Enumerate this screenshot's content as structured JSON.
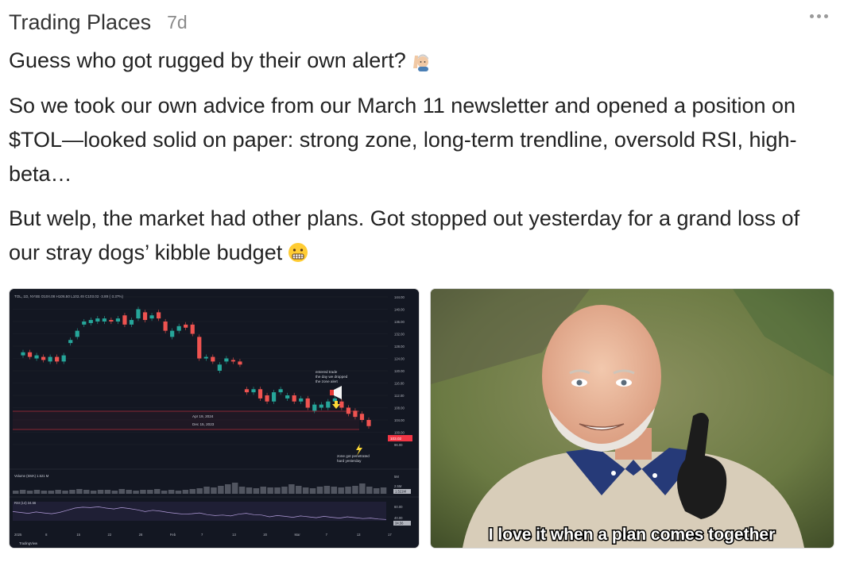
{
  "post": {
    "author": "Trading Places",
    "time_ago": "7d",
    "more_icon": "more-horizontal-icon",
    "paragraphs": [
      "Guess who got rugged by their own alert?",
      "So we took our own advice from our March 11 newsletter and opened a position on $TOL—looked solid on paper: strong zone, long-term trendline, oversold RSI, high-beta…",
      "But welp, the market had other plans. Got stopped out yesterday for a grand loss of our stray dogs’ kibble budget"
    ],
    "emojis": [
      "person-raising-hand-emoji",
      "grimacing-face-emoji"
    ]
  },
  "chart": {
    "header": "TOL, 1D, NYSE  O104.08  H106.50  L102.49  C103.02  -3.89 (-3.37%)",
    "annotation_entry": [
      "entered trade",
      "the day we dropped",
      "the zone alert"
    ],
    "annotation_zone": [
      "zone got penetrated",
      "hard yesterday"
    ],
    "zone_labels": [
      "Apr 19, 2024",
      "Dec 15, 2023"
    ],
    "price_ticks": [
      "144.00",
      "140.00",
      "136.00",
      "132.00",
      "128.00",
      "124.00",
      "120.00",
      "116.00",
      "112.00",
      "108.00",
      "104.00",
      "100.00",
      "96.00"
    ],
    "last_price": "103.02",
    "volume_label": "Volume (SMA)  1.521 M",
    "volume_ticks": [
      "5M",
      "2.5M",
      "1.521M"
    ],
    "rsi_label": "RSI (14)  34.56",
    "rsi_ticks": [
      "60.00",
      "40.00",
      "34.56"
    ],
    "x_ticks": [
      "2025",
      "8",
      "15",
      "22",
      "28",
      "Feb",
      "7",
      "13",
      "20",
      "Mar",
      "7",
      "13",
      "17"
    ],
    "brand": "TradingView",
    "colors": {
      "up": "#26a69a",
      "down": "#ef5350",
      "bg": "#131722"
    }
  },
  "meme": {
    "caption": "I love it when a plan comes together"
  }
}
